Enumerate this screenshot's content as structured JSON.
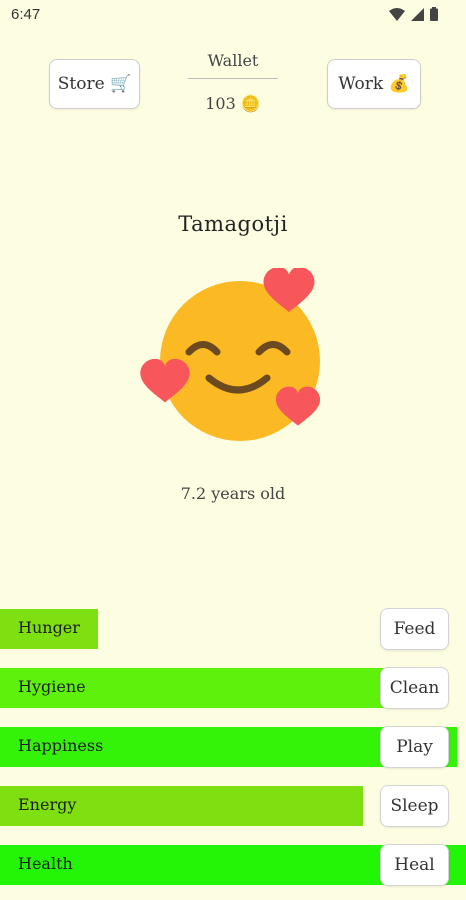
{
  "status_bar": {
    "time": "6:47",
    "icons": [
      "wifi-icon",
      "cell-signal-icon",
      "battery-icon"
    ]
  },
  "header": {
    "store_label": "Store 🛒",
    "work_label": "Work 💰",
    "wallet_label": "Wallet",
    "wallet_amount": "103 🪙"
  },
  "pet": {
    "name": "Tamagotji",
    "age": "7.2 years old",
    "emoji": "smiling-face-with-hearts"
  },
  "stats": [
    {
      "label": "Hunger",
      "action": "Feed",
      "level": 0.21,
      "color": "#7ee011"
    },
    {
      "label": "Hygiene",
      "action": "Clean",
      "level": 0.88,
      "color": "#5df10b"
    },
    {
      "label": "Happiness",
      "action": "Play",
      "level": 0.98,
      "color": "#34f308"
    },
    {
      "label": "Energy",
      "action": "Sleep",
      "level": 0.78,
      "color": "#7ee011"
    },
    {
      "label": "Health",
      "action": "Heal",
      "level": 1.0,
      "color": "#22f505"
    }
  ],
  "colors": {
    "background": "#fdfde2",
    "button_bg": "#ffffff",
    "face": "#fbb924",
    "heart": "#f7575a"
  }
}
